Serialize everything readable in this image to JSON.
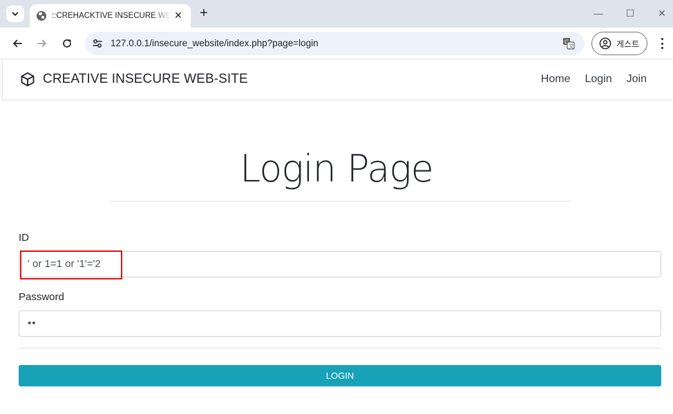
{
  "browser": {
    "tab_title": "::CREHACKTIVE INSECURE WEBSITE",
    "url": "127.0.0.1/insecure_website/index.php?page=login",
    "profile_label": "게스트",
    "close_glyph": "✕",
    "newtab_glyph": "+",
    "minimize_glyph": "—",
    "maximize_glyph": "☐",
    "window_close_glyph": "✕"
  },
  "site": {
    "brand_name": "CREATIVE INSECURE WEB-SITE",
    "nav": [
      "Home",
      "Login",
      "Join"
    ]
  },
  "login": {
    "title": "Login Page",
    "id_label": "ID",
    "id_value": "' or 1=1 or '1'='2",
    "password_label": "Password",
    "password_value": "••",
    "submit_label": "LOGIN"
  },
  "colors": {
    "accent": "#17a2b8",
    "highlight": "#e01010",
    "tabstrip": "#dfe3eb"
  },
  "icons": [
    "tab-search-icon",
    "globe-icon",
    "back-icon",
    "forward-icon",
    "reload-icon",
    "site-info-icon",
    "translate-icon",
    "profile-icon",
    "menu-icon",
    "cube-icon"
  ]
}
